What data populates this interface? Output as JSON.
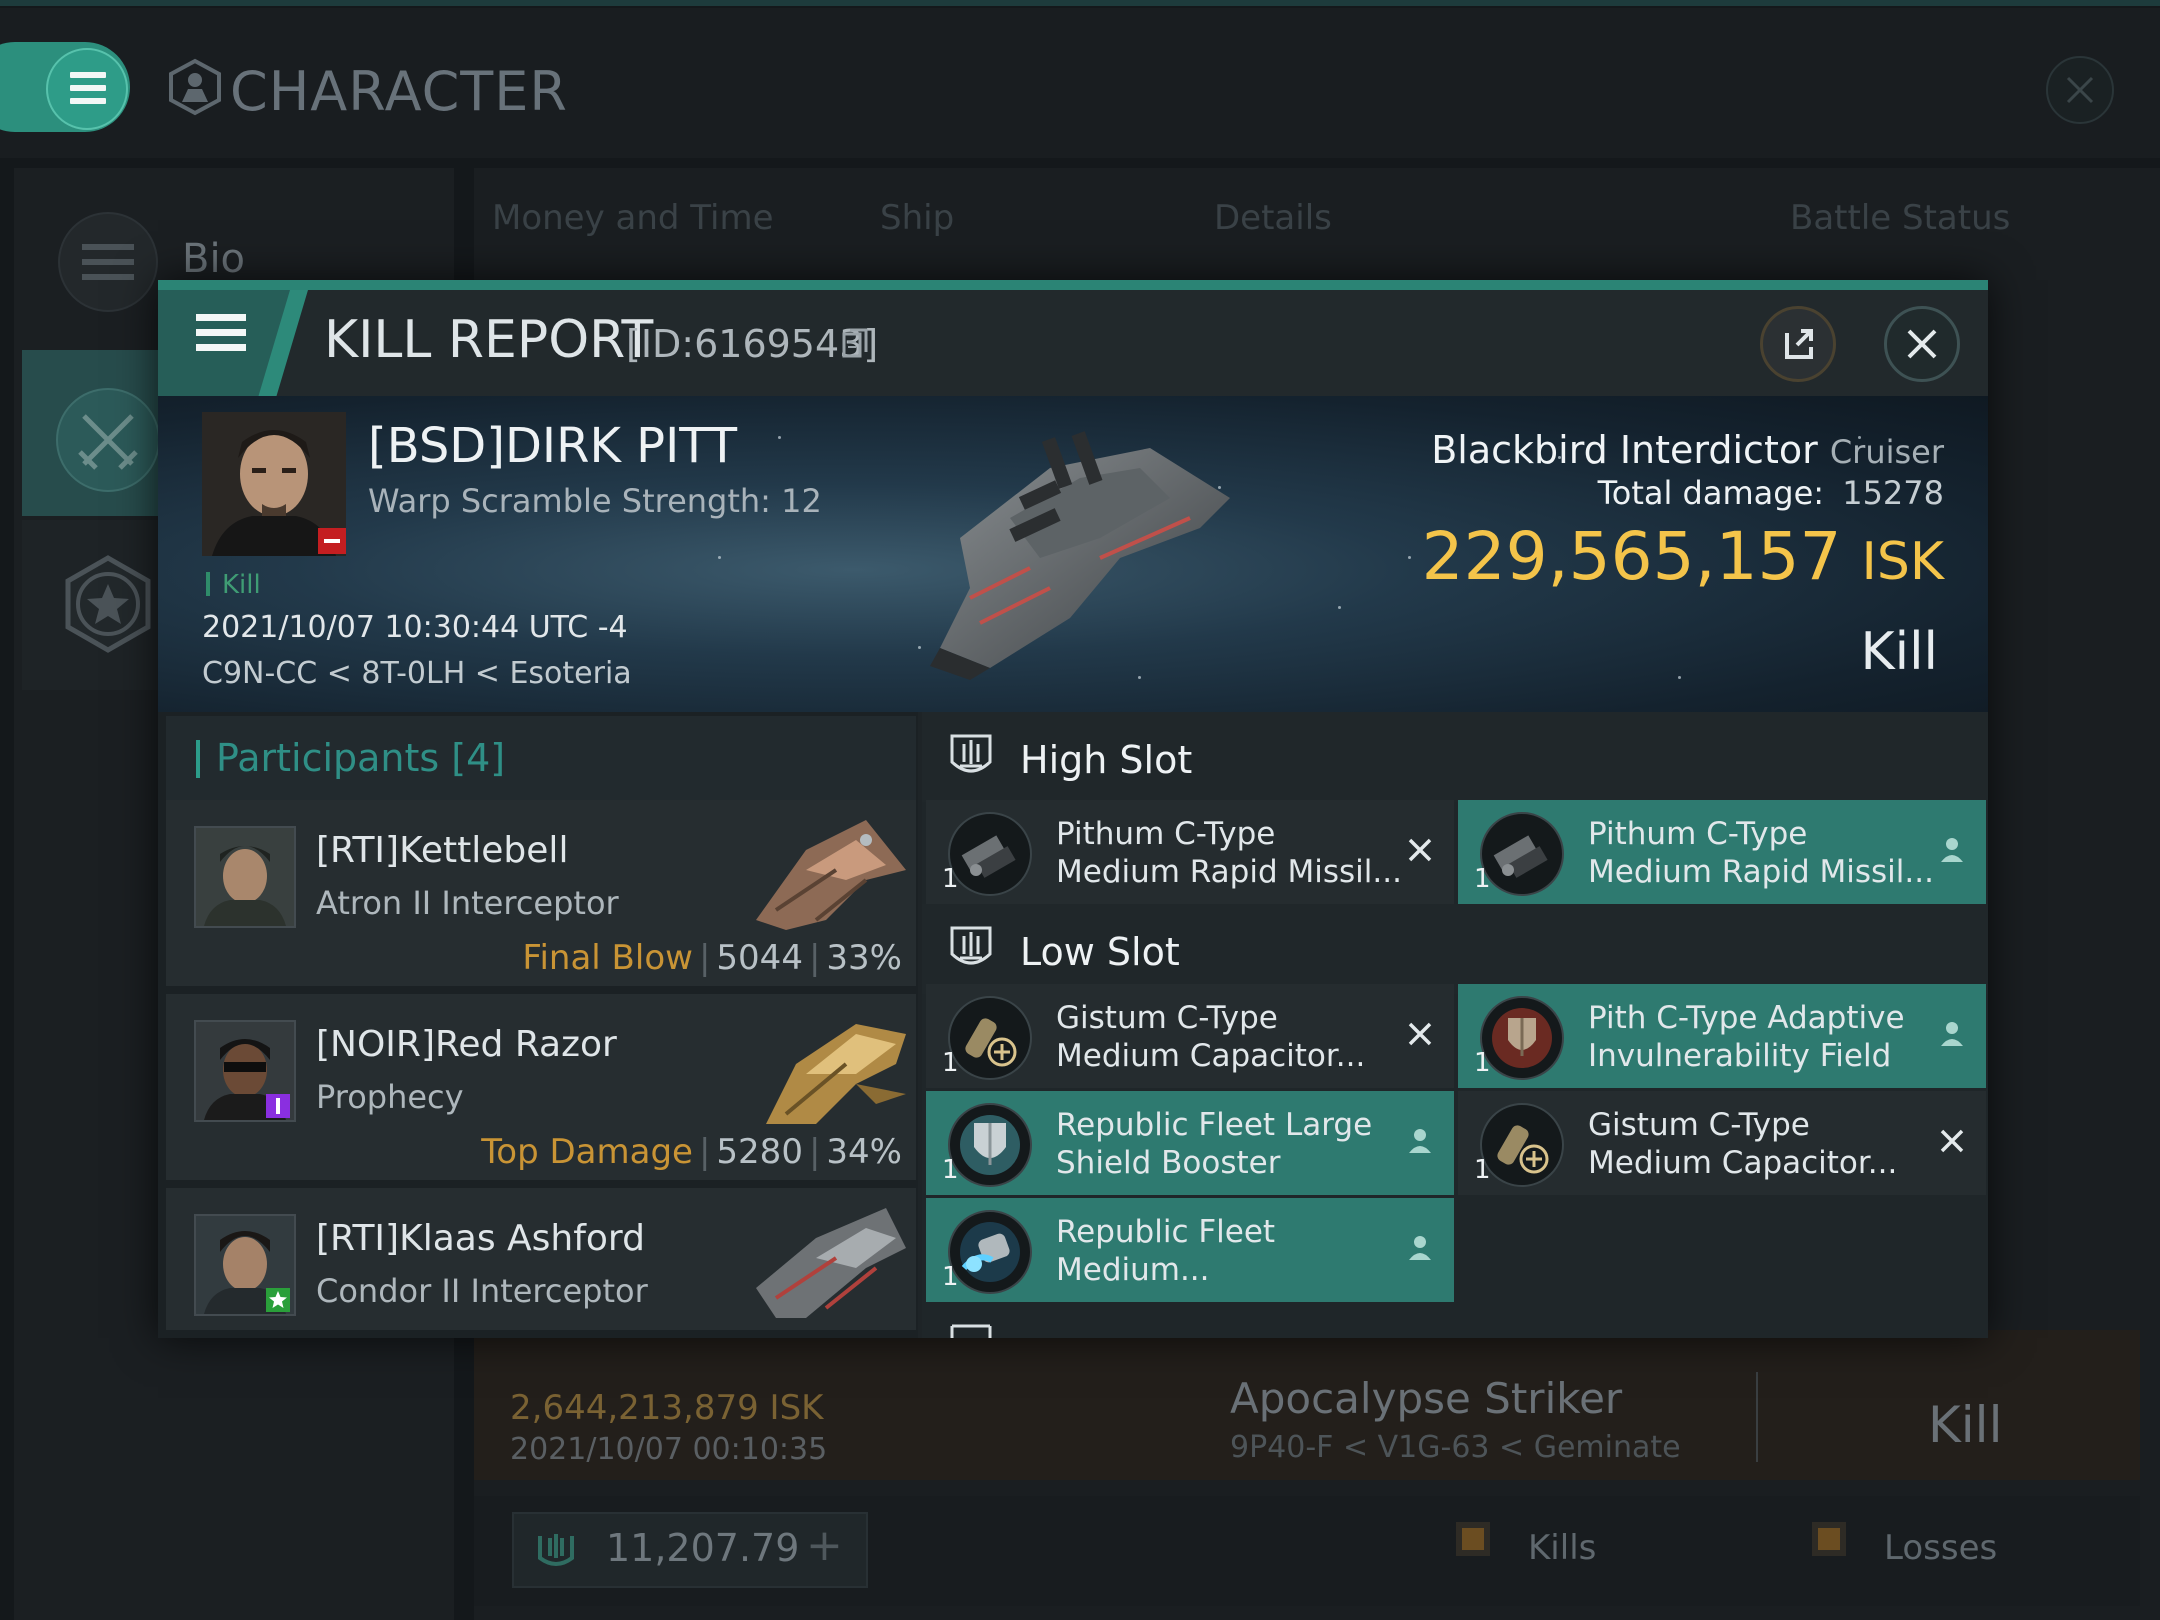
{
  "background": {
    "title": "CHARACTER",
    "sidebar": [
      {
        "label": "Bio",
        "icon": "menu-icon"
      },
      {
        "label": "",
        "icon": "crossed-swords-icon"
      },
      {
        "label": "",
        "icon": "star-badge-icon"
      }
    ],
    "tabs": [
      "Money and Time",
      "Ship",
      "Details",
      "Battle Status"
    ],
    "card": {
      "isk": "2,644,213,879 ISK",
      "date": "2021/10/07  00:10:35",
      "ship": "Apocalypse Striker",
      "location": "9P40-F < V1G-63 < Geminate",
      "result": "Kill"
    },
    "wallet": "11,207.79",
    "kills_label": "Kills",
    "losses_label": "Losses"
  },
  "report": {
    "title": "KILL REPORT",
    "id": "[ID:6169543]",
    "victim": {
      "name": "[BSD]DIRK PITT",
      "warp_scramble": "Warp Scramble Strength: 12",
      "tag": "Kill",
      "date": "2021/10/07 10:30:44 UTC -4",
      "location": "C9N-CC < 8T-0LH < Esoteria"
    },
    "ship": {
      "name": "Blackbird Interdictor",
      "class": "Cruiser",
      "total_damage_label": "Total damage:",
      "total_damage": "15278",
      "isk_value": "229,565,157",
      "isk_unit": "ISK",
      "result": "Kill"
    },
    "participants_title": "Participants [4]",
    "participants": [
      {
        "name": "[RTI]Kettlebell",
        "ship": "Atron II Interceptor",
        "tag": "Final Blow",
        "damage": "5044",
        "percent": "33%"
      },
      {
        "name": "[NOIR]Red Razor",
        "ship": "Prophecy",
        "tag": "Top Damage",
        "damage": "5280",
        "percent": "34%"
      },
      {
        "name": "[RTI]Klaas Ashford",
        "ship": "Condor II Interceptor",
        "tag": "",
        "damage": "",
        "percent": ""
      }
    ],
    "slots": {
      "high": {
        "label": "High Slot",
        "items": [
          {
            "line1": "Pithum C-Type",
            "line2": "Medium Rapid Missil...",
            "qty": "1",
            "status": "destroyed"
          },
          {
            "line1": "Pithum C-Type",
            "line2": "Medium Rapid Missil...",
            "qty": "1",
            "status": "dropped"
          }
        ]
      },
      "low": {
        "label": "Low Slot",
        "items": [
          {
            "line1": "Gistum C-Type",
            "line2": "Medium Capacitor...",
            "qty": "1",
            "status": "destroyed"
          },
          {
            "line1": "Pith C-Type Adaptive",
            "line2": "Invulnerability Field",
            "qty": "1",
            "status": "dropped"
          },
          {
            "line1": "Republic Fleet Large",
            "line2": "Shield Booster",
            "qty": "1",
            "status": "dropped"
          },
          {
            "line1": "Gistum C-Type",
            "line2": "Medium Capacitor...",
            "qty": "1",
            "status": "destroyed"
          },
          {
            "line1": "Republic Fleet",
            "line2": "Medium...",
            "qty": "1",
            "status": "dropped"
          }
        ]
      }
    }
  },
  "colors": {
    "accent": "#2c8f7d",
    "isk_gold": "#f4c44a",
    "dropped_item": "#2e7a70",
    "tag_gold": "#c99435"
  }
}
